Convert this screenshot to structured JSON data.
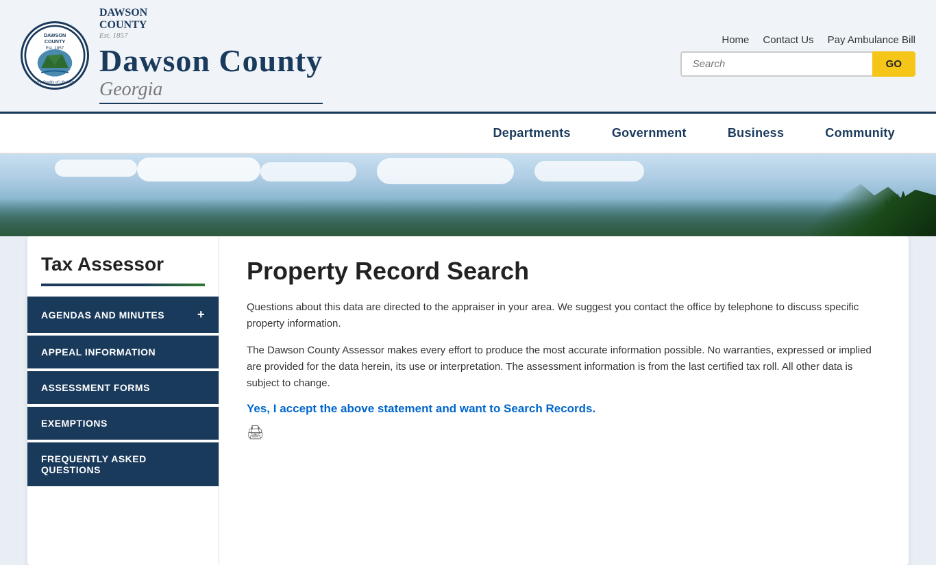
{
  "header": {
    "logo_alt": "Dawson County Georgia seal",
    "county_name_part1": "Dawson",
    "county_name_part2": "County",
    "county_subtitle": "Georgia",
    "nav_links": {
      "home": "Home",
      "contact": "Contact Us",
      "ambulance": "Pay Ambulance Bill"
    },
    "search_placeholder": "Search",
    "search_button": "GO"
  },
  "nav": {
    "items": [
      {
        "id": "departments",
        "label": "Departments"
      },
      {
        "id": "government",
        "label": "Government"
      },
      {
        "id": "business",
        "label": "Business"
      },
      {
        "id": "community",
        "label": "Community"
      }
    ]
  },
  "sidebar": {
    "title": "Tax Assessor",
    "items": [
      {
        "id": "agendas",
        "label": "AGENDAS AND MINUTES",
        "has_plus": true
      },
      {
        "id": "appeal",
        "label": "APPEAL INFORMATION",
        "has_plus": false
      },
      {
        "id": "assessment",
        "label": "ASSESSMENT FORMS",
        "has_plus": false
      },
      {
        "id": "exemptions",
        "label": "EXEMPTIONS",
        "has_plus": false
      },
      {
        "id": "faq",
        "label": "FREQUENTLY ASKED QUESTIONS",
        "has_plus": false
      }
    ]
  },
  "main": {
    "page_title": "Property Record Search",
    "paragraph1": "Questions about this data are directed to the appraiser in your area.  We suggest you contact the office by telephone to discuss specific property information.",
    "paragraph2": "The Dawson County Assessor makes every effort to produce the most accurate information possible. No warranties, expressed or implied are provided for the data herein, its use or interpretation. The assessment information is from the last certified tax roll. All other data is subject to change.",
    "accept_link": "Yes, I accept the above statement and want to Search Records.",
    "print_icon": "🖨"
  }
}
